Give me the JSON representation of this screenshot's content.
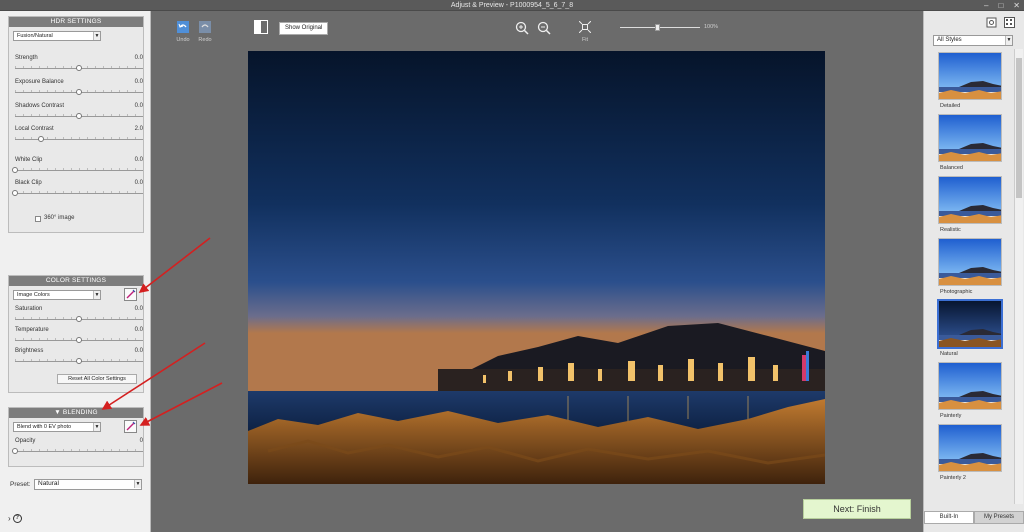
{
  "window": {
    "title": "Adjust & Preview - P1000954_5_6_7_8"
  },
  "hdr_settings": {
    "header": "HDR SETTINGS",
    "mode": "Fusion/Natural",
    "sliders": [
      {
        "label": "Strength",
        "value": "0.0",
        "pos": 0.5
      },
      {
        "label": "Exposure Balance",
        "value": "0.0",
        "pos": 0.5
      },
      {
        "label": "Shadows Contrast",
        "value": "0.0",
        "pos": 0.5
      },
      {
        "label": "Local Contrast",
        "value": "2.0",
        "pos": 0.2
      },
      {
        "label": "White Clip",
        "value": "0.0",
        "pos": 0.0
      },
      {
        "label": "Black Clip",
        "value": "0.0",
        "pos": 0.0
      }
    ],
    "checkbox_360": "360° image"
  },
  "color_settings": {
    "header": "COLOR SETTINGS",
    "mode": "Image Colors",
    "sliders": [
      {
        "label": "Saturation",
        "value": "0.0",
        "pos": 0.5
      },
      {
        "label": "Temperature",
        "value": "0.0",
        "pos": 0.5
      },
      {
        "label": "Brightness",
        "value": "0.0",
        "pos": 0.5
      }
    ],
    "reset_label": "Reset All Color Settings"
  },
  "blending": {
    "header": "BLENDING",
    "mode": "Blend with 0 EV photo",
    "opacity_label": "Opacity",
    "opacity_value": "0",
    "opacity_pos": 0.0
  },
  "preset": {
    "label": "Preset:",
    "value": "Natural"
  },
  "toolbar": {
    "undo": "Undo",
    "redo": "Redo",
    "show_original": "Show Original",
    "fit": "Fit",
    "zoom_value": "100%",
    "zoom_pos": 0.47
  },
  "next_button": "Next: Finish",
  "styles_panel": {
    "filter": "All Styles",
    "presets": [
      {
        "name": "Detailed",
        "selected": false
      },
      {
        "name": "Balanced",
        "selected": false
      },
      {
        "name": "Realistic",
        "selected": false
      },
      {
        "name": "Photographic",
        "selected": false
      },
      {
        "name": "Natural",
        "selected": true
      },
      {
        "name": "Painterly",
        "selected": false
      },
      {
        "name": "Painterly 2",
        "selected": false
      }
    ],
    "tabs": [
      "Built-In",
      "My Presets"
    ]
  },
  "colors": {
    "header_gray": "#7d7d7d",
    "next_green": "#e4f6cf",
    "annotation_red": "#d42020",
    "selected_blue": "#3b6fd4"
  }
}
